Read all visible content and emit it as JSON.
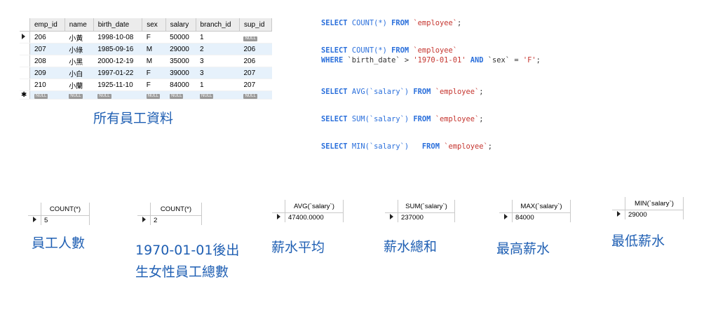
{
  "employee_table": {
    "columns": [
      "emp_id",
      "name",
      "birth_date",
      "sex",
      "salary",
      "branch_id",
      "sup_id"
    ],
    "rows": [
      [
        "206",
        "小黃",
        "1998-10-08",
        "F",
        "50000",
        "1",
        "NULL"
      ],
      [
        "207",
        "小綠",
        "1985-09-16",
        "M",
        "29000",
        "2",
        "206"
      ],
      [
        "208",
        "小黑",
        "2000-12-19",
        "M",
        "35000",
        "3",
        "206"
      ],
      [
        "209",
        "小白",
        "1997-01-22",
        "F",
        "39000",
        "3",
        "207"
      ],
      [
        "210",
        "小蘭",
        "1925-11-10",
        "F",
        "84000",
        "1",
        "207"
      ]
    ],
    "new_row": [
      "NULL",
      "NULL",
      "NULL",
      "NULL",
      "NULL",
      "NULL",
      "NULL"
    ],
    "caption": "所有員工資料"
  },
  "sql": {
    "q1": {
      "k1": "SELECT",
      "f1": "COUNT(*)",
      "k2": "FROM",
      "s1": "`employee`",
      "end": ";"
    },
    "q2": {
      "k1": "SELECT",
      "f1": "COUNT(*)",
      "k2": "FROM",
      "s1": "`employee`",
      "k3": "WHERE",
      "p1": "`birth_date` > ",
      "v1": "'1970-01-01'",
      "k4": "AND",
      "p2": "`sex` = ",
      "v2": "'F'",
      "end": ";"
    },
    "q3": {
      "k1": "SELECT",
      "f1": "AVG(`salary`)",
      "k2": "FROM",
      "s1": "`employee`",
      "end": ";"
    },
    "q4": {
      "k1": "SELECT",
      "f1": "SUM(`salary`)",
      "k2": "FROM",
      "s1": "`employee`",
      "end": ";"
    },
    "q5": {
      "k1": "SELECT",
      "f1": "MIN(`salary`)",
      "k2": "FROM",
      "s1": "`employee`",
      "end": ";"
    }
  },
  "results": [
    {
      "header": "COUNT(*)",
      "value": "5",
      "caption1": "員工人數",
      "caption2": ""
    },
    {
      "header": "COUNT(*)",
      "value": "2",
      "caption1": "1970-01-01後出",
      "caption2": "生女性員工總數"
    },
    {
      "header": "AVG(`salary`)",
      "value": "47400.0000",
      "caption1": "薪水平均",
      "caption2": ""
    },
    {
      "header": "SUM(`salary`)",
      "value": "237000",
      "caption1": "薪水總和",
      "caption2": ""
    },
    {
      "header": "MAX(`salary`)",
      "value": "84000",
      "caption1": "最高薪水",
      "caption2": ""
    },
    {
      "header": "MIN(`salary`)",
      "value": "29000",
      "caption1": "最低薪水",
      "caption2": ""
    }
  ]
}
